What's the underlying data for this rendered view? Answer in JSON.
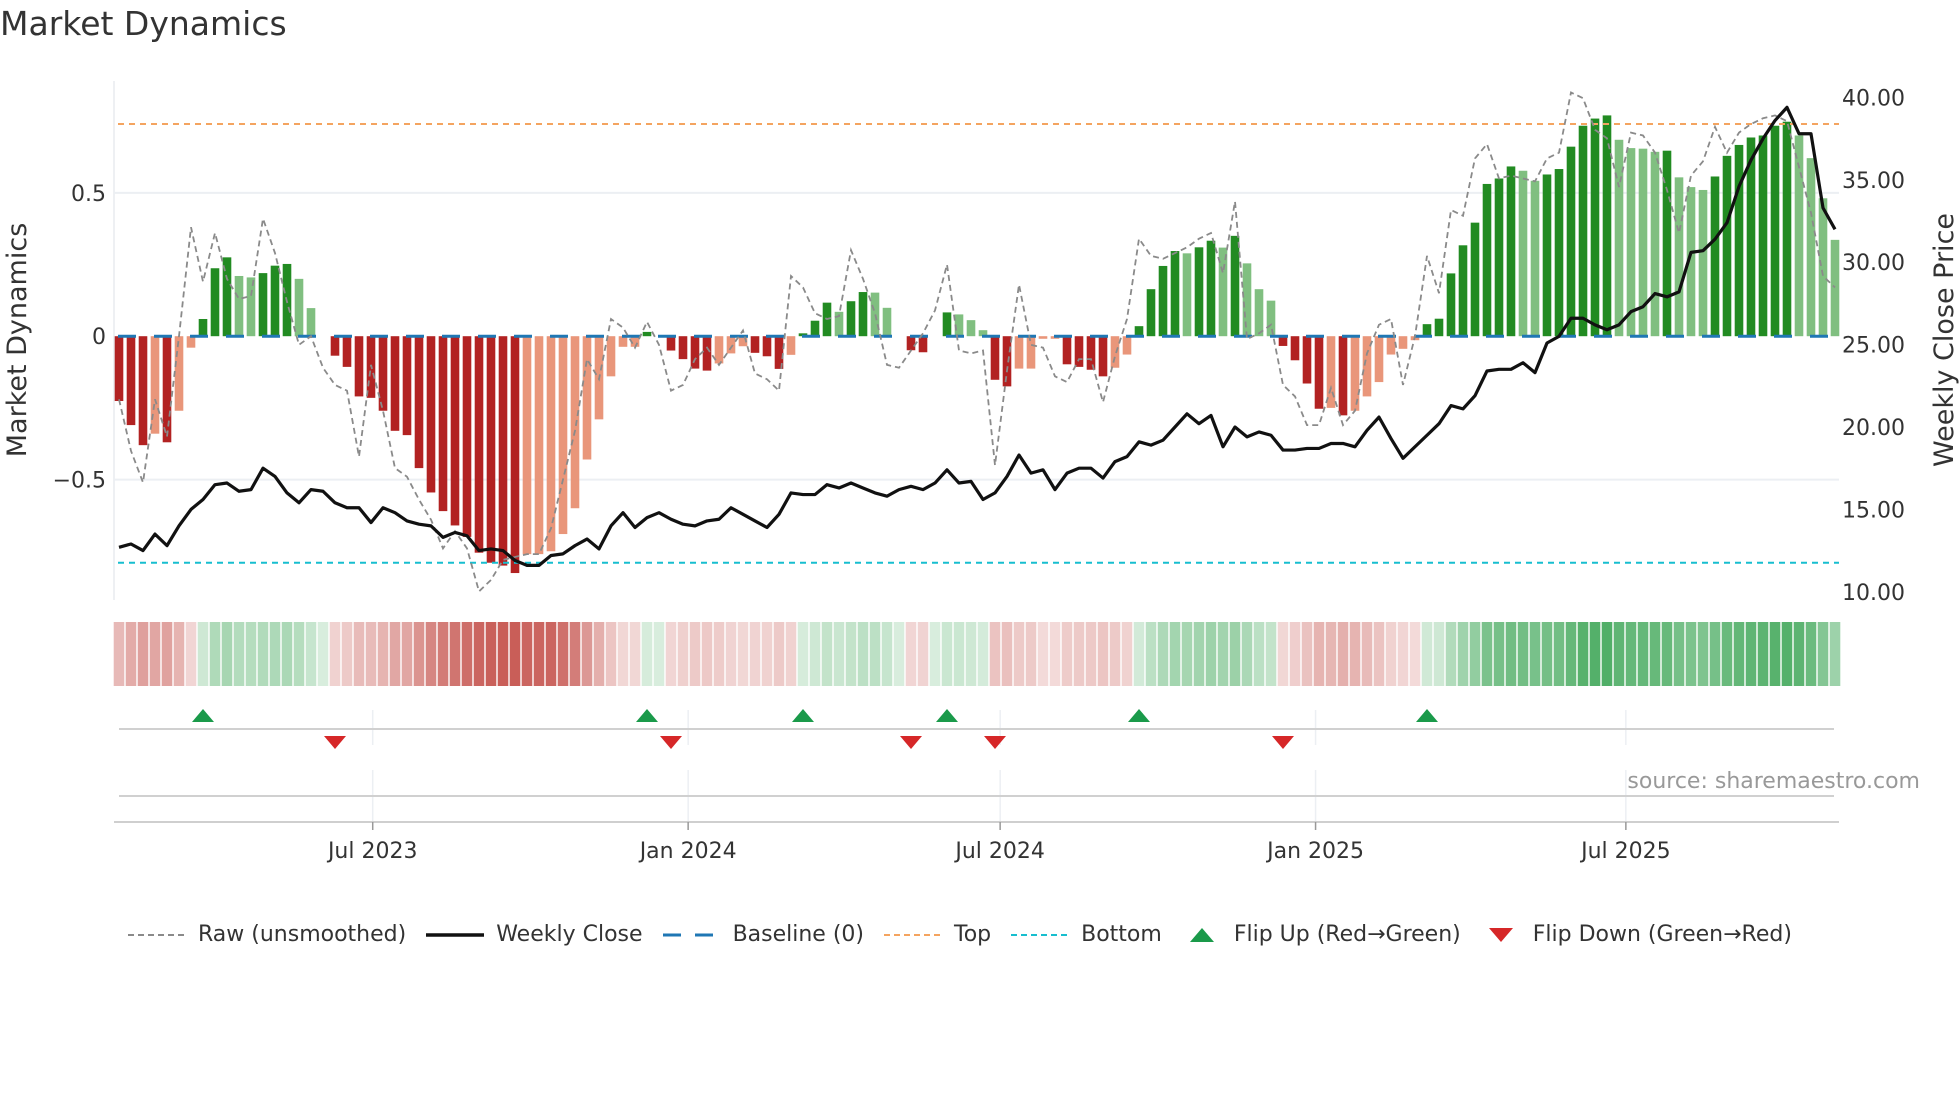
{
  "title": "Market Dynamics",
  "source": "source: sharemaestro.com",
  "legend": {
    "raw": "Raw (unsmoothed)",
    "close": "Weekly Close",
    "baseline": "Baseline (0)",
    "top": "Top",
    "bottom": "Bottom",
    "flip_up": "Flip Up (Red→Green)",
    "flip_down": "Flip Down (Green→Red)"
  },
  "colors": {
    "dark_red": "#b22222",
    "light_red": "#e9967a",
    "dark_green": "#228b22",
    "light_green": "#80bf80",
    "raw": "#8a8a8a",
    "close": "#111111",
    "baseline": "#1f77b4",
    "top": "#f4a460",
    "bottom": "#17becf",
    "flip_up": "#1a9a4a",
    "flip_down": "#d62728",
    "heat_red": "#c4504a",
    "heat_green": "#3ca555"
  },
  "chart_data": {
    "type": "bar",
    "title": "Market Dynamics",
    "xlabel": "",
    "ylabel": "Market Dynamics",
    "y2label": "Weekly Close Price",
    "start_date": "2023-02-03",
    "frequency": "weekly",
    "ylim": [
      -0.92,
      0.89
    ],
    "y2lim": [
      9.5,
      41
    ],
    "yticks": [
      {
        "v": 0.5,
        "label": "0.5"
      },
      {
        "v": 0,
        "label": "0"
      },
      {
        "v": -0.5,
        "label": "−0.5"
      }
    ],
    "y2ticks": [
      {
        "v": 40,
        "label": "40.00"
      },
      {
        "v": 35,
        "label": "35.00"
      },
      {
        "v": 30,
        "label": "30.00"
      },
      {
        "v": 25,
        "label": "25.00"
      },
      {
        "v": 20,
        "label": "20.00"
      },
      {
        "v": 15,
        "label": "15.00"
      },
      {
        "v": 10,
        "label": "10.00"
      }
    ],
    "xticks": [
      {
        "date": "2023-07-01",
        "label": "Jul 2023"
      },
      {
        "date": "2024-01-01",
        "label": "Jan 2024"
      },
      {
        "date": "2024-07-01",
        "label": "Jul 2024"
      },
      {
        "date": "2025-01-01",
        "label": "Jan 2025"
      },
      {
        "date": "2025-07-01",
        "label": "Jul 2025"
      }
    ],
    "top_level": 0.74,
    "bottom_level": -0.79,
    "baseline": 0,
    "smoothed": [
      -0.226,
      -0.31,
      -0.38,
      -0.34,
      -0.37,
      -0.26,
      -0.04,
      0.06,
      0.237,
      0.275,
      0.21,
      0.205,
      0.22,
      0.246,
      0.252,
      0.2,
      0.098,
      0,
      -0.068,
      -0.107,
      -0.21,
      -0.215,
      -0.26,
      -0.33,
      -0.345,
      -0.46,
      -0.545,
      -0.61,
      -0.66,
      -0.7,
      -0.755,
      -0.79,
      -0.8,
      -0.826,
      -0.76,
      -0.76,
      -0.75,
      -0.69,
      -0.6,
      -0.43,
      -0.29,
      -0.14,
      -0.037,
      -0.037,
      0.015,
      0,
      -0.05,
      -0.08,
      -0.113,
      -0.12,
      -0.095,
      -0.06,
      -0.035,
      -0.058,
      -0.07,
      -0.114,
      -0.065,
      0.01,
      0.054,
      0.117,
      0.085,
      0.122,
      0.154,
      0.152,
      0.099,
      0,
      -0.049,
      -0.056,
      0,
      0.083,
      0.076,
      0.056,
      0.021,
      -0.152,
      -0.175,
      -0.113,
      -0.113,
      -0.009,
      -0.009,
      -0.098,
      -0.107,
      -0.117,
      -0.14,
      -0.11,
      -0.064,
      0.035,
      0.164,
      0.245,
      0.297,
      0.289,
      0.31,
      0.333,
      0.309,
      0.35,
      0.254,
      0.164,
      0.124,
      -0.034,
      -0.084,
      -0.165,
      -0.253,
      -0.25,
      -0.276,
      -0.26,
      -0.21,
      -0.16,
      -0.064,
      -0.044,
      -0.014,
      0.042,
      0.061,
      0.219,
      0.317,
      0.396,
      0.531,
      0.55,
      0.592,
      0.577,
      0.542,
      0.564,
      0.583,
      0.661,
      0.734,
      0.759,
      0.77,
      0.685,
      0.656,
      0.654,
      0.643,
      0.647,
      0.554,
      0.52,
      0.51,
      0.557,
      0.629,
      0.667,
      0.693,
      0.7,
      0.734,
      0.748,
      0.7,
      0.621,
      0.481,
      0.336
    ],
    "shades": "DDDLDLLDDDLLDDDLL0DDDDDDDDDDDDDDDDLLLLLLLLLLD0DDDDLLLDDDLDDDLDDLL0DD0DLLLDDLLLLDDDDLLDDDDLDDLDLLLDDDDLDLLLLLLDDDDDDDDLLDDDDDDLLLLDLLLDDDDDDDLLLL",
    "raw": [
      -0.22,
      -0.4,
      -0.51,
      -0.22,
      -0.35,
      0,
      0.38,
      0.19,
      0.36,
      0.2,
      0.13,
      0.14,
      0.41,
      0.29,
      0.12,
      -0.03,
      0,
      -0.11,
      -0.17,
      -0.19,
      -0.42,
      -0.1,
      -0.26,
      -0.46,
      -0.49,
      -0.57,
      -0.64,
      -0.74,
      -0.68,
      -0.74,
      -0.89,
      -0.85,
      -0.78,
      -0.77,
      -0.76,
      -0.76,
      -0.67,
      -0.5,
      -0.33,
      -0.08,
      -0.15,
      0.06,
      0.03,
      -0.04,
      0.05,
      -0.03,
      -0.19,
      -0.17,
      -0.08,
      -0.04,
      -0.1,
      -0.04,
      0.02,
      -0.13,
      -0.15,
      -0.19,
      0.21,
      0.17,
      0.08,
      0.06,
      0.07,
      0.3,
      0.2,
      0.08,
      -0.1,
      -0.11,
      -0.05,
      0.01,
      0.09,
      0.25,
      -0.05,
      -0.06,
      -0.05,
      -0.45,
      -0.12,
      0.18,
      -0.03,
      -0.04,
      -0.14,
      -0.16,
      -0.08,
      -0.08,
      -0.23,
      -0.07,
      0.06,
      0.34,
      0.28,
      0.27,
      0.29,
      0.31,
      0.34,
      0.36,
      0.22,
      0.47,
      -0.01,
      0.01,
      0.04,
      -0.17,
      -0.21,
      -0.31,
      -0.31,
      -0.18,
      -0.31,
      -0.26,
      -0.06,
      0.04,
      0.06,
      -0.17,
      0,
      0.28,
      0.15,
      0.44,
      0.42,
      0.62,
      0.67,
      0.55,
      0.56,
      0.55,
      0.54,
      0.62,
      0.64,
      0.85,
      0.83,
      0.72,
      0.69,
      0.52,
      0.71,
      0.7,
      0.64,
      0.51,
      0.36,
      0.56,
      0.61,
      0.73,
      0.64,
      0.71,
      0.74,
      0.76,
      0.77,
      0.75,
      0.59,
      0.43,
      0.21,
      0.17
    ],
    "close": [
      12.7,
      12.9,
      12.5,
      13.5,
      12.8,
      14.0,
      15.0,
      15.6,
      16.5,
      16.6,
      16.1,
      16.2,
      17.5,
      17.0,
      16.0,
      15.4,
      16.2,
      16.1,
      15.4,
      15.1,
      15.1,
      14.2,
      15.1,
      14.8,
      14.3,
      14.1,
      14.0,
      13.3,
      13.6,
      13.4,
      12.5,
      12.6,
      12.5,
      11.9,
      11.6,
      11.6,
      12.2,
      12.3,
      12.8,
      13.2,
      12.6,
      14.0,
      14.8,
      13.9,
      14.5,
      14.8,
      14.4,
      14.1,
      14.0,
      14.3,
      14.4,
      15.1,
      14.7,
      14.3,
      13.9,
      14.7,
      16.0,
      15.9,
      15.9,
      16.5,
      16.3,
      16.6,
      16.3,
      16.0,
      15.8,
      16.2,
      16.4,
      16.2,
      16.6,
      17.4,
      16.6,
      16.7,
      15.6,
      16.0,
      17.0,
      18.3,
      17.2,
      17.4,
      16.2,
      17.2,
      17.5,
      17.5,
      16.9,
      17.9,
      18.2,
      19.1,
      18.9,
      19.2,
      20.0,
      20.8,
      20.2,
      20.7,
      18.8,
      20.0,
      19.4,
      19.7,
      19.5,
      18.6,
      18.6,
      18.7,
      18.7,
      19.0,
      19.0,
      18.8,
      19.8,
      20.6,
      19.3,
      18.1,
      18.8,
      19.5,
      20.2,
      21.3,
      21.1,
      21.9,
      23.4,
      23.5,
      23.5,
      23.9,
      23.3,
      25.1,
      25.5,
      26.6,
      26.6,
      26.2,
      25.9,
      26.2,
      27.0,
      27.3,
      28.1,
      27.9,
      28.2,
      30.6,
      30.7,
      31.4,
      32.4,
      34.6,
      36.2,
      37.5,
      38.6,
      39.4,
      37.8,
      37.8,
      33.3,
      32.0
    ],
    "flip_up_weeks": [
      8,
      45,
      58,
      70,
      86,
      110
    ],
    "flip_down_weeks": [
      19,
      47,
      67,
      74,
      98
    ],
    "legend_placement": "bottom",
    "grid": true
  }
}
